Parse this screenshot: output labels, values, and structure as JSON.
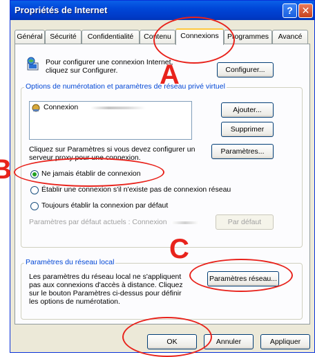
{
  "window": {
    "title": "Propriétés de Internet",
    "help_label": "?",
    "close_label": "✕"
  },
  "tabs": [
    {
      "label": "Général"
    },
    {
      "label": "Sécurité"
    },
    {
      "label": "Confidentialité"
    },
    {
      "label": "Contenu"
    },
    {
      "label": "Connexions"
    },
    {
      "label": "Programmes"
    },
    {
      "label": "Avancé"
    }
  ],
  "setup": {
    "text_line1": "Pour configurer une connexion Internet,",
    "text_line2": "cliquez sur Configurer.",
    "configure_button": "Configurer..."
  },
  "dialup": {
    "legend": "Options de numérotation et paramètres de réseau privé virtuel",
    "connection_item": "Connexion",
    "add_button": "Ajouter...",
    "remove_button": "Supprimer",
    "settings_text_line1": "Cliquez sur Paramètres si vous devez configurer un",
    "settings_text_line2": "serveur proxy pour une connexion.",
    "settings_button": "Paramètres...",
    "radio1": "Ne jamais établir de connexion",
    "radio2": "Établir une connexion s'il n'existe pas de connexion réseau",
    "radio3": "Toujours établir la connexion par défaut",
    "current_default_label": "Paramètres par défaut actuels : Connexion",
    "set_default_button": "Par défaut"
  },
  "lan": {
    "legend": "Paramètres du réseau local",
    "text_line1": "Les paramètres du réseau local ne s'appliquent",
    "text_line2": "pas aux connexions d'accès à distance. Cliquez",
    "text_line3": "sur le bouton Paramètres ci-dessus pour définir",
    "text_line4": "les options de numérotation.",
    "lan_settings_button": "Paramètres réseau..."
  },
  "footer": {
    "ok": "OK",
    "cancel": "Annuler",
    "apply": "Appliquer"
  },
  "annotations": {
    "a": "A",
    "b": "B",
    "c": "C",
    "color": "#e8231c"
  }
}
